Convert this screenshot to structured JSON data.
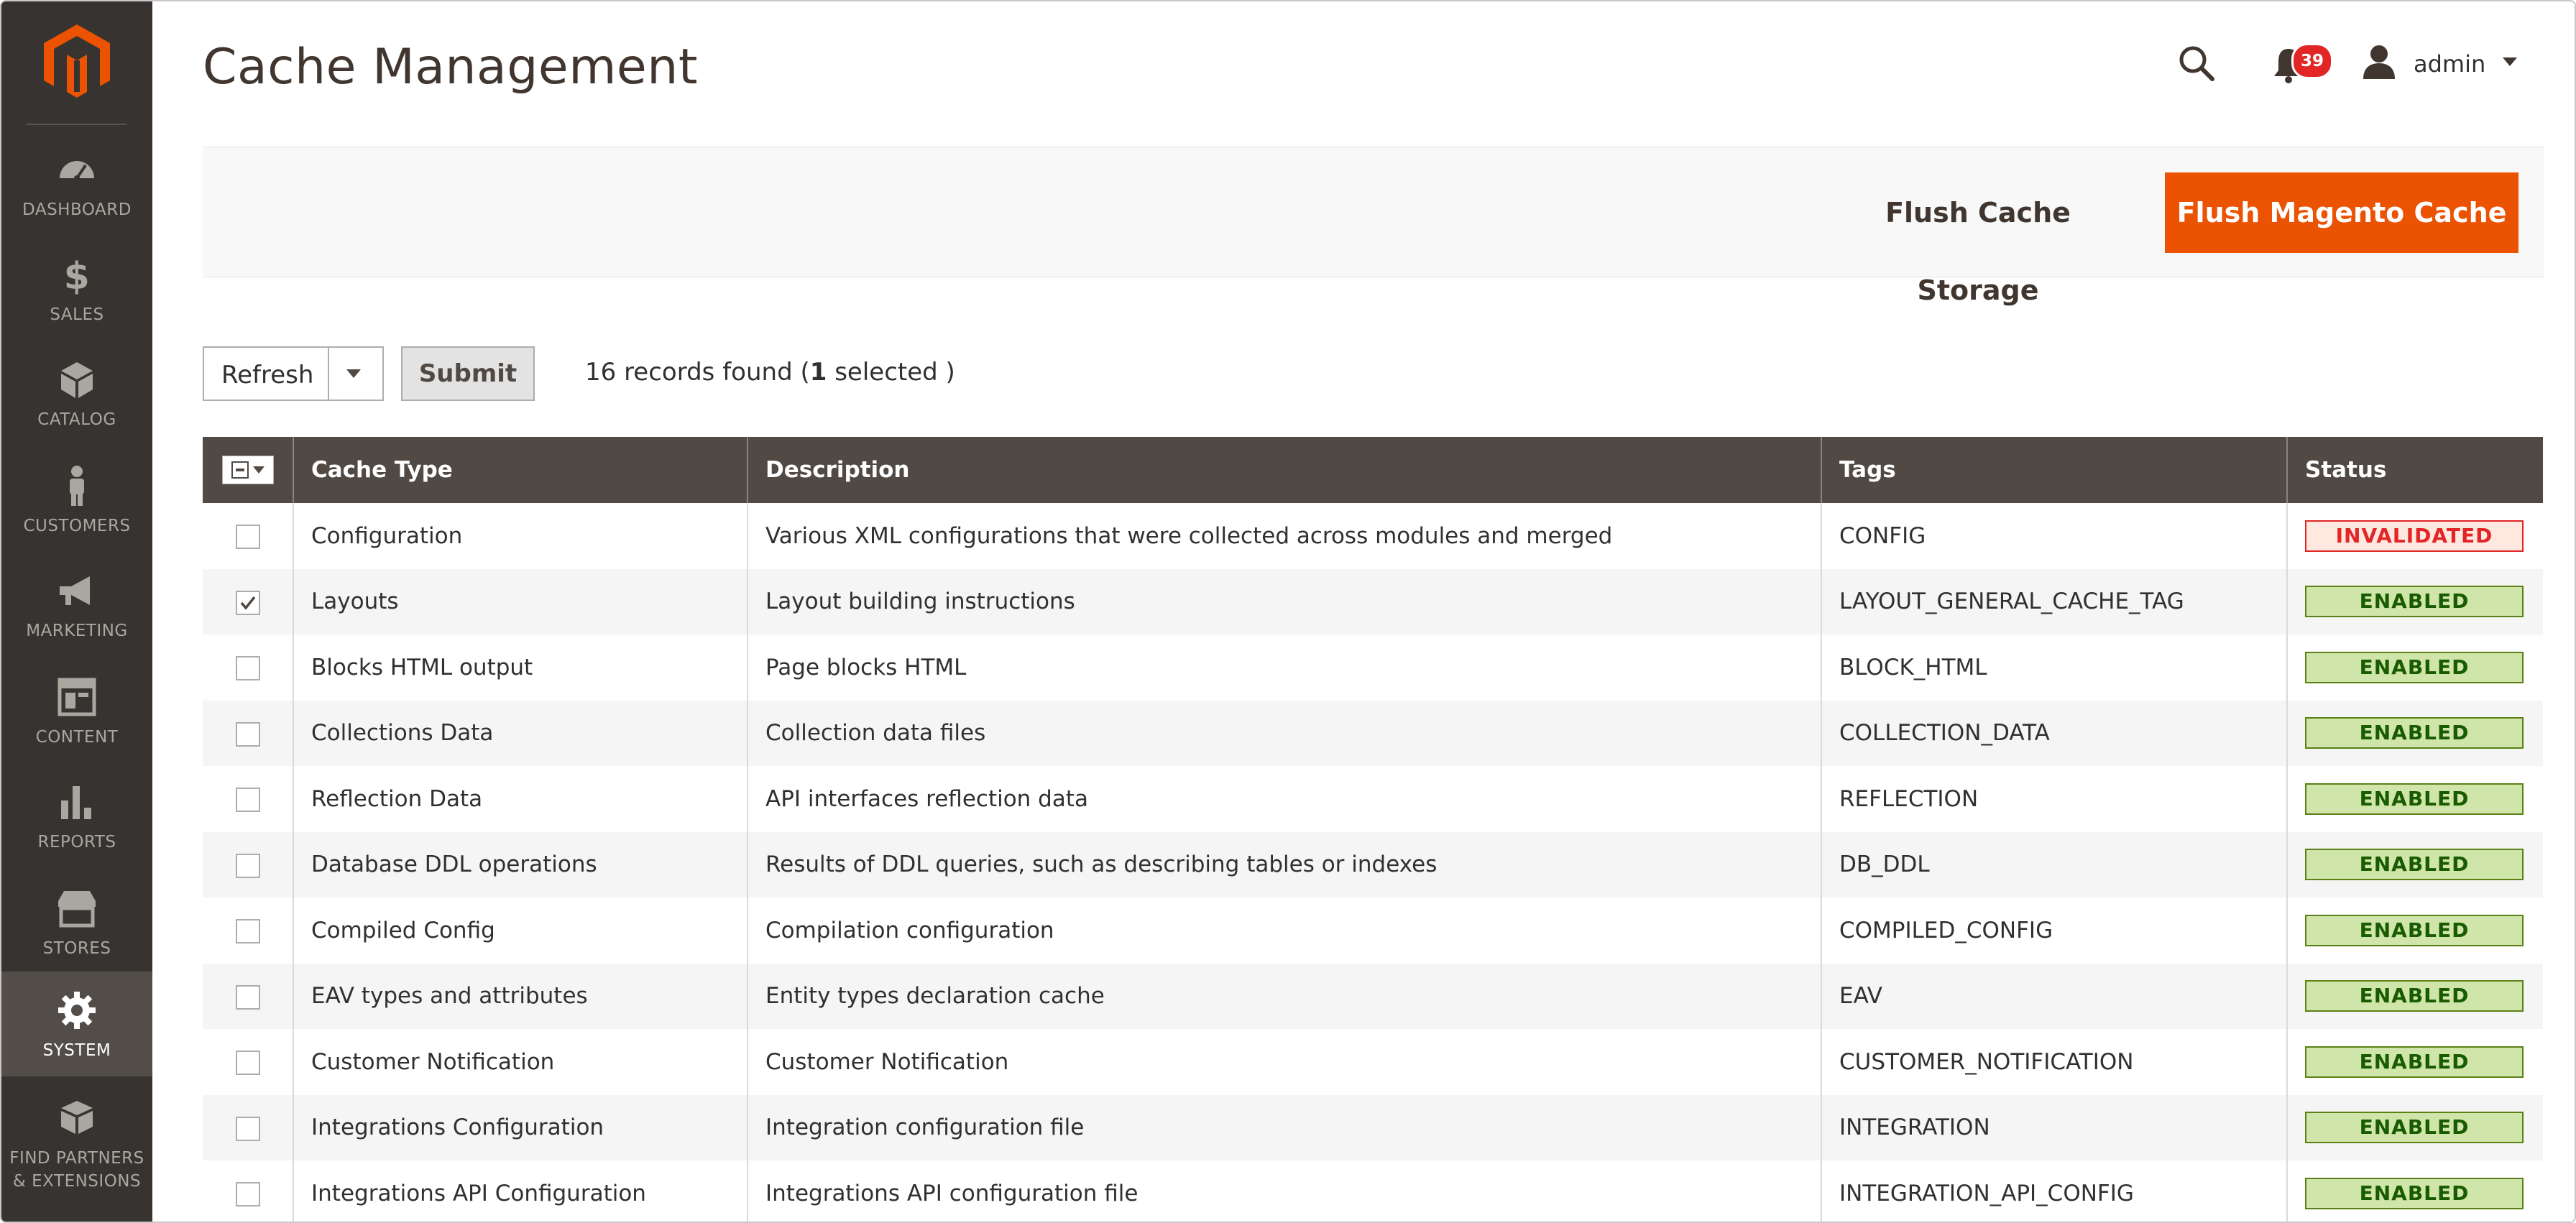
{
  "sidebar": {
    "items": [
      {
        "label": "DASHBOARD",
        "icon": "dashboard-icon",
        "active": false
      },
      {
        "label": "SALES",
        "icon": "dollar-icon",
        "active": false
      },
      {
        "label": "CATALOG",
        "icon": "cube-icon",
        "active": false
      },
      {
        "label": "CUSTOMERS",
        "icon": "person-icon",
        "active": false
      },
      {
        "label": "MARKETING",
        "icon": "megaphone-icon",
        "active": false
      },
      {
        "label": "CONTENT",
        "icon": "layout-icon",
        "active": false
      },
      {
        "label": "REPORTS",
        "icon": "bar-chart-icon",
        "active": false
      },
      {
        "label": "STORES",
        "icon": "storefront-icon",
        "active": false
      },
      {
        "label": "SYSTEM",
        "icon": "gear-icon",
        "active": true
      },
      {
        "label": "FIND PARTNERS & EXTENSIONS",
        "icon": "boxes-icon",
        "active": false
      }
    ]
  },
  "header": {
    "title": "Cache Management",
    "notification_count": "39",
    "user": "admin"
  },
  "actions": {
    "flush_storage": "Flush Cache Storage",
    "flush_magento": "Flush Magento Cache"
  },
  "mass_action": {
    "selected": "Refresh",
    "submit": "Submit",
    "records_prefix": "16 records found (",
    "selected_count": "1",
    "records_suffix": " selected )"
  },
  "grid": {
    "columns": [
      "Cache Type",
      "Description",
      "Tags",
      "Status"
    ],
    "rows": [
      {
        "checked": false,
        "type": "Configuration",
        "description": "Various XML configurations that were collected across modules and merged",
        "tags": "CONFIG",
        "status": "INVALIDATED"
      },
      {
        "checked": true,
        "type": "Layouts",
        "description": "Layout building instructions",
        "tags": "LAYOUT_GENERAL_CACHE_TAG",
        "status": "ENABLED"
      },
      {
        "checked": false,
        "type": "Blocks HTML output",
        "description": "Page blocks HTML",
        "tags": "BLOCK_HTML",
        "status": "ENABLED"
      },
      {
        "checked": false,
        "type": "Collections Data",
        "description": "Collection data files",
        "tags": "COLLECTION_DATA",
        "status": "ENABLED"
      },
      {
        "checked": false,
        "type": "Reflection Data",
        "description": "API interfaces reflection data",
        "tags": "REFLECTION",
        "status": "ENABLED"
      },
      {
        "checked": false,
        "type": "Database DDL operations",
        "description": "Results of DDL queries, such as describing tables or indexes",
        "tags": "DB_DDL",
        "status": "ENABLED"
      },
      {
        "checked": false,
        "type": "Compiled Config",
        "description": "Compilation configuration",
        "tags": "COMPILED_CONFIG",
        "status": "ENABLED"
      },
      {
        "checked": false,
        "type": "EAV types and attributes",
        "description": "Entity types declaration cache",
        "tags": "EAV",
        "status": "ENABLED"
      },
      {
        "checked": false,
        "type": "Customer Notification",
        "description": "Customer Notification",
        "tags": "CUSTOMER_NOTIFICATION",
        "status": "ENABLED"
      },
      {
        "checked": false,
        "type": "Integrations Configuration",
        "description": "Integration configuration file",
        "tags": "INTEGRATION",
        "status": "ENABLED"
      },
      {
        "checked": false,
        "type": "Integrations API Configuration",
        "description": "Integrations API configuration file",
        "tags": "INTEGRATION_API_CONFIG",
        "status": "ENABLED"
      }
    ]
  },
  "colors": {
    "sidebar_bg": "#373330",
    "accent": "#eb5202",
    "grid_header": "#514943",
    "enabled_bg": "#d0e5a9",
    "invalidated_text": "#e22626"
  }
}
